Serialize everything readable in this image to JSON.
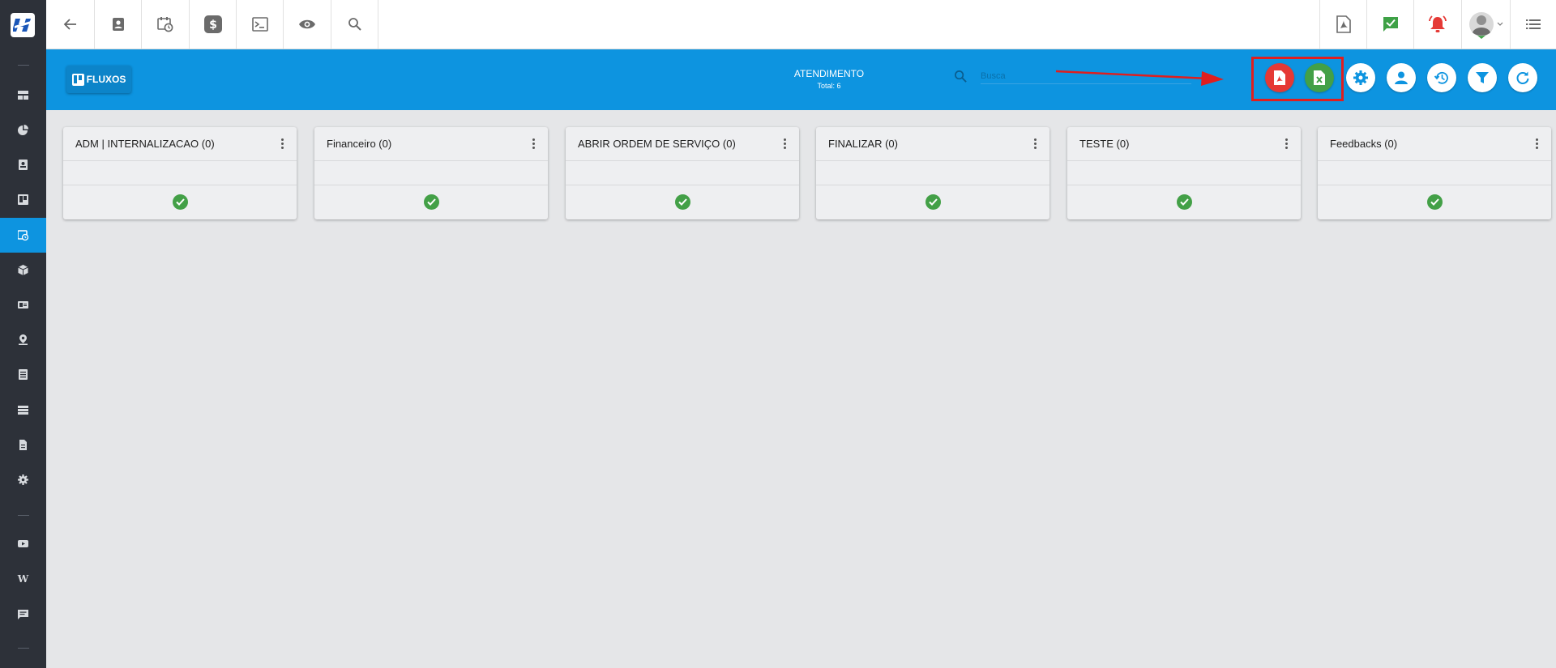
{
  "sidebar": {
    "items": [
      {
        "icon": "dashboard-icon"
      },
      {
        "icon": "pie-chart-icon"
      },
      {
        "icon": "contact-card-icon"
      },
      {
        "icon": "board-icon"
      },
      {
        "icon": "calendar-clock-icon",
        "active": true
      },
      {
        "icon": "package-icon"
      },
      {
        "icon": "id-card-icon"
      },
      {
        "icon": "map-pin-icon"
      },
      {
        "icon": "list-icon"
      },
      {
        "icon": "server-icon"
      },
      {
        "icon": "document-icon"
      },
      {
        "icon": "gear-icon"
      },
      {
        "icon": "video-icon"
      },
      {
        "icon": "wiki-icon",
        "glyph": "W"
      },
      {
        "icon": "chat-icon"
      }
    ]
  },
  "toolbar": {
    "left": [
      "back-arrow-icon",
      "contact-icon",
      "calendar-clock-icon",
      "dollar-icon",
      "terminal-icon",
      "eye-icon",
      "search-icon"
    ],
    "right": [
      "pdf-icon",
      "task-check-icon",
      "alarm-bell-icon",
      "avatar",
      "list-menu-icon"
    ]
  },
  "header": {
    "fluxos_label": "FLUXOS",
    "title": "ATENDIMENTO",
    "total": "Total: 6",
    "search_placeholder": "Busca"
  },
  "header_actions": [
    "export-pdf-icon",
    "export-excel-icon",
    "settings-icon",
    "user-icon",
    "history-icon",
    "filter-icon",
    "refresh-icon"
  ],
  "colors": {
    "sidebar": "#2d3139",
    "accent": "#0d94e0",
    "pdf_red": "#e53935",
    "excel_green": "#43a047",
    "highlight": "#e01e1e"
  },
  "columns": [
    {
      "name": "ADM | INTERNALIZACAO (0)"
    },
    {
      "name": "Financeiro (0)"
    },
    {
      "name": "ABRIR ORDEM DE SERVIÇO (0)"
    },
    {
      "name": "FINALIZAR (0)"
    },
    {
      "name": "TESTE (0)"
    },
    {
      "name": "Feedbacks (0)"
    }
  ]
}
